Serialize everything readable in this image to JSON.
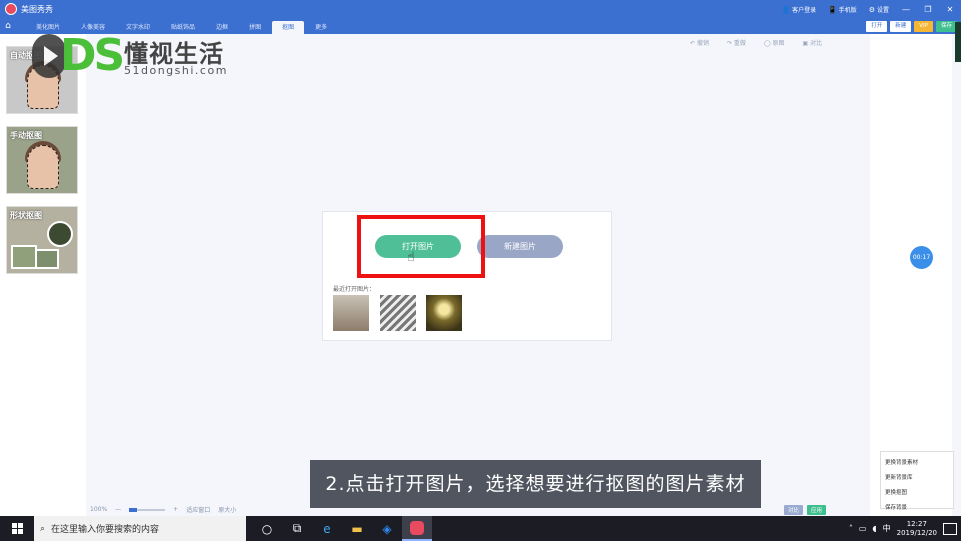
{
  "app": {
    "title": "美图秀秀"
  },
  "titlebar": {
    "items": [
      {
        "icon": "person-icon",
        "label": "客户登录"
      },
      {
        "icon": "phone-icon",
        "label": "手机版"
      },
      {
        "icon": "gear-icon",
        "label": "设置"
      }
    ],
    "window_buttons": [
      "—",
      "❐",
      "✕"
    ]
  },
  "tabs": [
    {
      "label": "美化图片",
      "active": false
    },
    {
      "label": "人像美容",
      "active": false
    },
    {
      "label": "文字水印",
      "active": false
    },
    {
      "label": "贴纸饰品",
      "active": false
    },
    {
      "label": "边框",
      "active": false
    },
    {
      "label": "拼图",
      "active": false
    },
    {
      "label": "抠图",
      "active": true
    },
    {
      "label": "更多",
      "active": false
    }
  ],
  "tab_actions": {
    "open": "打开",
    "new": "新建",
    "vip": "VIP",
    "save": "保存"
  },
  "sidebar": {
    "cards": [
      {
        "label": "自动抠图"
      },
      {
        "label": "手动抠图"
      },
      {
        "label": "形状抠图"
      }
    ]
  },
  "watermark": {
    "brand": "DS",
    "name": "懂视生活",
    "url": "51dongshi.com"
  },
  "toolbar": {
    "items": [
      "撤销",
      "重做",
      "原图",
      "对比"
    ]
  },
  "dialog": {
    "open_button": "打开图片",
    "new_button": "新建图片",
    "recent_label": "最近打开图片："
  },
  "timer": "00:17",
  "popup": {
    "items": [
      "更换背景素材",
      "更新背景库",
      "更换抠图",
      "保存背景"
    ]
  },
  "zoom": {
    "value": "100%",
    "labels": [
      "适应窗口",
      "原大小"
    ]
  },
  "compare": {
    "left": "对比",
    "right": "应用"
  },
  "subtitle": "2.点击打开图片，选择想要进行抠图的图片素材",
  "taskbar": {
    "search_placeholder": "在这里输入你要搜索的内容",
    "ime": "中",
    "time": "12:27",
    "date": "2019/12/20"
  }
}
